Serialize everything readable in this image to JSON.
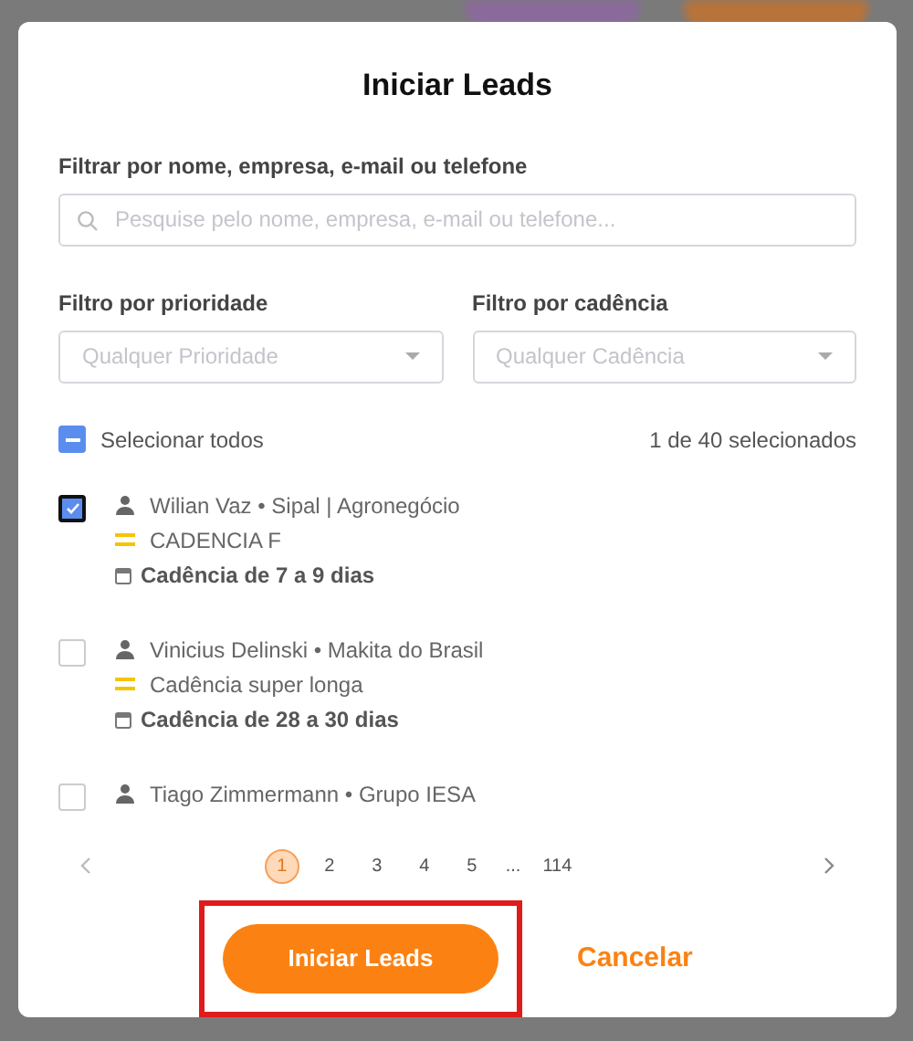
{
  "dialog": {
    "title": "Iniciar Leads"
  },
  "search": {
    "label": "Filtrar por nome, empresa, e-mail ou telefone",
    "placeholder": "Pesquise pelo nome, empresa, e-mail ou telefone..."
  },
  "filters": [
    {
      "label": "Filtro por prioridade",
      "placeholder": "Qualquer Prioridade"
    },
    {
      "label": "Filtro por cadência",
      "placeholder": "Qualquer Cadência"
    }
  ],
  "select_all": {
    "label": "Selecionar todos",
    "indeterminate": true,
    "count": "1 de 40 selecionados"
  },
  "leads": [
    {
      "name": "Wilian Vaz • Sipal | Agronegócio",
      "cadence": "CADENCIA F",
      "interval": "Cadência de 7 a 9 dias",
      "selected": true
    },
    {
      "name": "Vinicius Delinski • Makita do Brasil",
      "cadence": "Cadência super longa",
      "interval": "Cadência de 28 a 30 dias",
      "selected": false
    },
    {
      "name": "Tiago Zimmermann • Grupo IESA",
      "selected": false
    }
  ],
  "pagination": {
    "pages": [
      {
        "label": "1",
        "selected": true
      },
      {
        "label": "2",
        "selected": false
      },
      {
        "label": "3",
        "selected": false
      },
      {
        "label": "4",
        "selected": false
      },
      {
        "label": "5",
        "selected": false
      },
      {
        "label": "...",
        "kind": "gap"
      },
      {
        "label": "114",
        "selected": false
      }
    ]
  },
  "actions": {
    "primary": {
      "label": "Iniciar Leads",
      "highlighted": true
    },
    "cancel": "Cancelar"
  }
}
